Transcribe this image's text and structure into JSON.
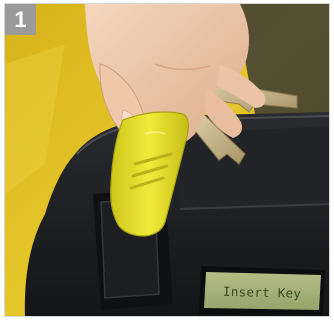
{
  "step": {
    "number": "1"
  },
  "display": {
    "text": "Insert Key"
  },
  "photo": {
    "subject": "hand-inserting-yellow-key-fob-into-machine",
    "colors": {
      "wall_yellow": "#e2c21e",
      "machine_dark": "#1c1d1f",
      "fob_yellow": "#e8e22a",
      "skin": "#eec9ac",
      "key_metal": "#c9b98f",
      "lcd_green": "#a7b27a"
    }
  }
}
